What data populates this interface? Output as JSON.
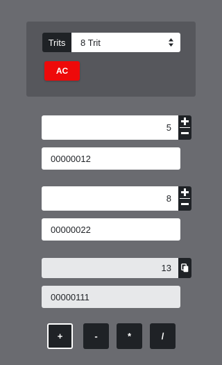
{
  "settings": {
    "trits_label": "Trits",
    "trits_selected": "8 Trit",
    "ac_label": "AC"
  },
  "operand_a": {
    "decimal": "5",
    "ternary": "00000012"
  },
  "operand_b": {
    "decimal": "8",
    "ternary": "00000022"
  },
  "result": {
    "decimal": "13",
    "ternary": "00000111"
  },
  "operators": [
    "+",
    "-",
    "*",
    "/"
  ],
  "active_operator": "+",
  "colors": {
    "background": "#6a6b70",
    "card": "#56575c",
    "dark": "#1f2226",
    "accent_red": "#ee0a0a",
    "disabled_field": "#e7e8ea"
  },
  "icons": {
    "select": "updown-chevron-icon",
    "increment": "plus-icon",
    "decrement": "minus-icon",
    "copy": "copy-icon"
  }
}
